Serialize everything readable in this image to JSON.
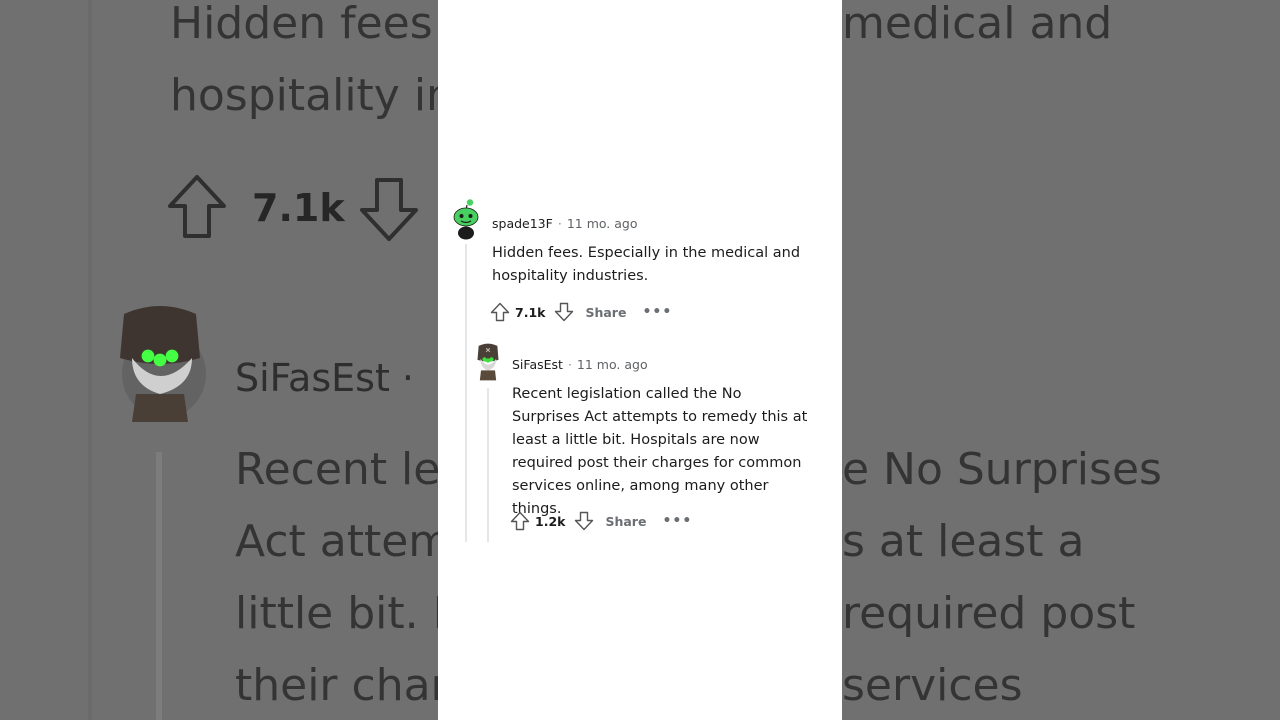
{
  "comments": [
    {
      "username": "spade13F",
      "age": "11 mo. ago",
      "text": "Hidden fees. Especially in the medical and hospitality industries.",
      "score": "7.1k",
      "share_label": "Share",
      "more_label": "•••",
      "avatar_icon": "snoo-green-avatar-icon"
    },
    {
      "username": "SiFasEst",
      "age": "11 mo. ago",
      "text": "Recent legislation called the No Surprises Act attempts to remedy this at least a little bit. Hospitals are now required post their charges for common services online, among many other things.",
      "score": "1.2k",
      "share_label": "Share",
      "more_label": "•••",
      "avatar_icon": "hooded-robot-avatar-icon"
    }
  ],
  "meta_separator": "·",
  "background": {
    "line1": "Hidden fees",
    "line1b": "medical and",
    "line2": "hospitality in",
    "score": "7.1k",
    "username": "SiFasEst ·",
    "text1": "Recent le",
    "text1b": "e No Surprises",
    "text2": "Act attem",
    "text2b": "s at least a",
    "text3": "little bit. H",
    "text3b": "required post",
    "text4": "their char",
    "text4b": "services"
  }
}
